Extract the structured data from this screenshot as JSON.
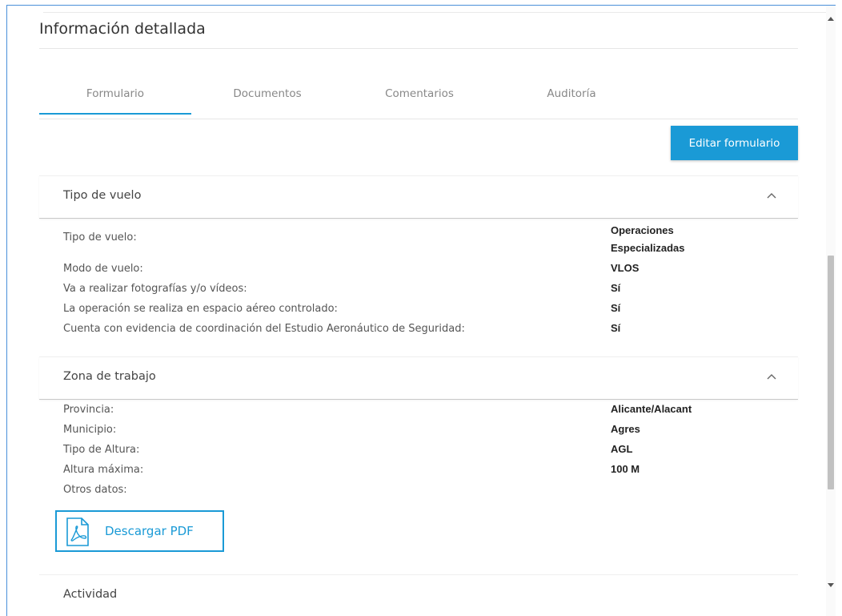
{
  "panel": {
    "title": "Información detallada"
  },
  "tabs": [
    {
      "label": "Formulario",
      "active": true
    },
    {
      "label": "Documentos",
      "active": false
    },
    {
      "label": "Comentarios",
      "active": false
    },
    {
      "label": "Auditoría",
      "active": false
    }
  ],
  "toolbar": {
    "edit_label": "Editar formulario"
  },
  "sections": {
    "vuelo": {
      "title": "Tipo de vuelo",
      "rows": [
        {
          "label": "Tipo de vuelo:",
          "value": "Operaciones Especializadas"
        },
        {
          "label": "Modo de vuelo:",
          "value": "VLOS"
        },
        {
          "label": "Va a realizar fotografías y/o vídeos:",
          "value": "Sí"
        },
        {
          "label": "La operación se realiza en espacio aéreo controlado:",
          "value": "Sí"
        },
        {
          "label": "Cuenta con evidencia de coordinación del Estudio Aeronáutico de Seguridad:",
          "value": "Sí"
        }
      ]
    },
    "zona": {
      "title": "Zona de trabajo",
      "rows": [
        {
          "label": "Provincia:",
          "value": "Alicante/Alacant"
        },
        {
          "label": "Municipio:",
          "value": "Agres"
        },
        {
          "label": "Tipo de Altura:",
          "value": "AGL"
        },
        {
          "label": "Altura máxima:",
          "value": "100 M"
        },
        {
          "label": "Otros datos:",
          "value": ""
        }
      ],
      "pdf_label": "Descargar PDF"
    },
    "actividad": {
      "title": "Actividad"
    }
  },
  "colors": {
    "accent": "#1a9ad6",
    "frame": "#4a90d9"
  },
  "icons": {
    "pdf": "pdf-file-icon",
    "collapse": "chevron-up-icon"
  }
}
